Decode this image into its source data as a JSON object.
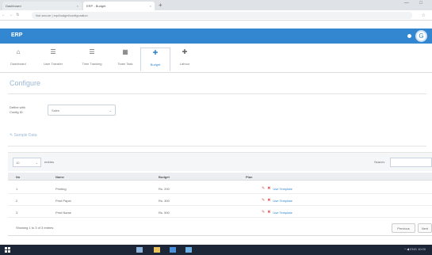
{
  "browser": {
    "tabs": [
      {
        "label": "Dashboard"
      },
      {
        "label": "ERP - Budget"
      }
    ],
    "new_tab": "+",
    "window_controls": "— □",
    "nav": {
      "back": "←",
      "forward": "→",
      "reload": "↻"
    },
    "url": "Not secure | erp/budget/configuration"
  },
  "app": {
    "logo": "ERP",
    "avatar_initial": "G"
  },
  "toolbar": {
    "items": [
      {
        "label": "Dashboard",
        "icon": "home-icon",
        "glyph": "⌂"
      },
      {
        "label": "User Transfer",
        "icon": "user-icon",
        "glyph": "☰"
      },
      {
        "label": "Time Tracking",
        "icon": "clock-icon",
        "glyph": "☰"
      },
      {
        "label": "Team Task",
        "icon": "task-icon",
        "glyph": "▦"
      },
      {
        "label": "Budget",
        "icon": "budget-icon",
        "glyph": "✚",
        "active": true
      },
      {
        "label": "Labour",
        "icon": "labour-icon",
        "glyph": "✚"
      }
    ]
  },
  "page": {
    "title": "Configure",
    "form_label_line1": "Define with",
    "form_label_line2": "Config ID",
    "select_value": "Sales",
    "section_title": "Sample Data"
  },
  "table": {
    "show_value": "10",
    "entries_label": "entries",
    "search_label": "Search:",
    "headers": [
      "No",
      "Name",
      "Budget",
      "Plan"
    ],
    "rows": [
      {
        "no": "1",
        "name": "Printing",
        "budget": "Rs. 200",
        "action": "Use Template"
      },
      {
        "no": "2",
        "name": "Print Paper",
        "budget": "Rs. 300",
        "action": "Use Template"
      },
      {
        "no": "3",
        "name": "Print Name",
        "budget": "Rs. 500",
        "action": "Use Template"
      }
    ],
    "info": "Showing 1 to 3 of 3 entries",
    "prev": "Previous",
    "next": "Next"
  },
  "taskbar": {
    "tray": "^ ◀ ENG 10:00"
  },
  "colors": {
    "header": "#3387d0",
    "title": "#9bb8d3",
    "action_red": "#e05a5a",
    "taskbar": "#1c2636"
  }
}
